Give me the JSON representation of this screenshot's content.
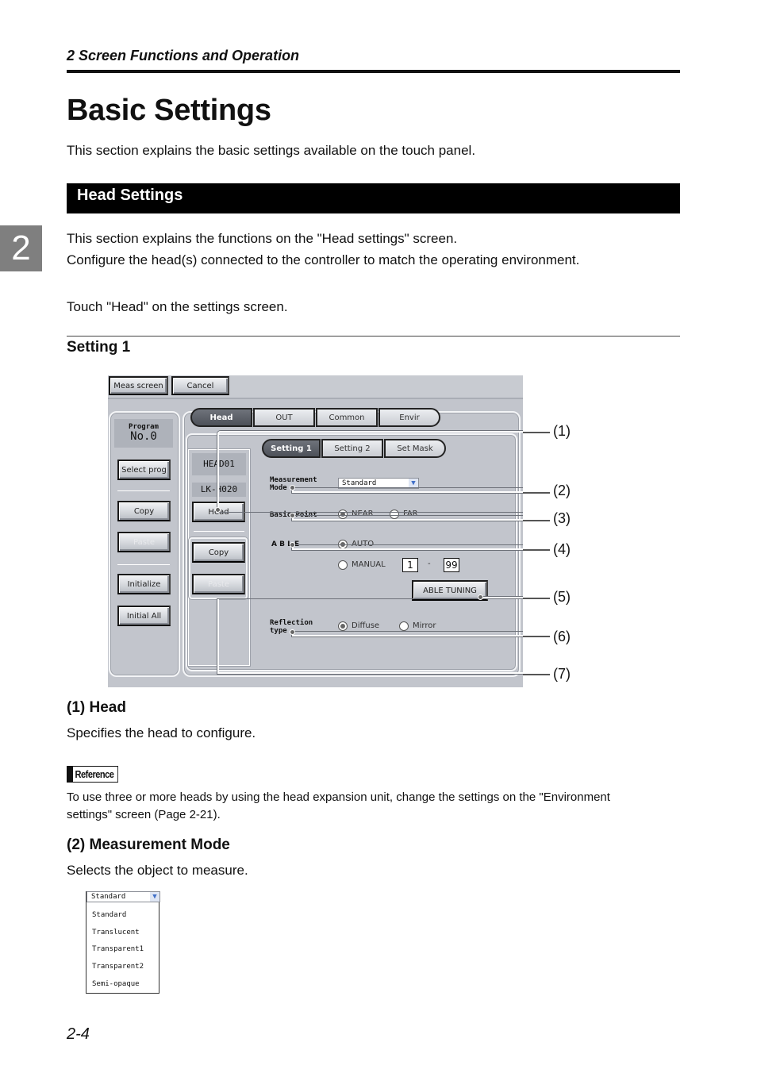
{
  "running_head": "2  Screen Functions and Operation",
  "chapter_tab": "2",
  "title": "Basic Settings",
  "intro": "This section explains the basic settings available on the touch panel.",
  "section_bar": "Head Settings",
  "section_text": [
    "This section explains the functions on the \"Head settings\" screen.",
    "Configure the head(s) connected to the controller to match the operating environment."
  ],
  "instruction": "Touch \"Head\" on the settings screen.",
  "subsection": "Setting 1",
  "screen": {
    "top_buttons": {
      "meas_screen": "Meas screen",
      "cancel": "Cancel"
    },
    "left_panel": {
      "program_label": "Program",
      "program_no": "No.0",
      "select_prog": "Select prog",
      "copy": "Copy",
      "paste": "Paste",
      "initialize": "Initialize",
      "initial_all": "Initial All"
    },
    "main_tabs": [
      "Head",
      "OUT",
      "Common",
      "Envir"
    ],
    "head_column": {
      "head_id": "HEAD01",
      "model": "LK-H020",
      "head_button": "Head",
      "copy": "Copy",
      "paste": "Paste"
    },
    "sub_tabs": [
      "Setting 1",
      "Setting 2",
      "Set Mask"
    ],
    "measurement_mode": {
      "label_line1": "Measurement",
      "label_line2": "Mode",
      "value": "Standard"
    },
    "basic_point": {
      "label": "Basic Point",
      "options": [
        "NEAR",
        "FAR"
      ],
      "selected": "NEAR"
    },
    "able": {
      "label": "A B L E",
      "auto": "AUTO",
      "manual": "MANUAL",
      "min": "1",
      "dash": "-",
      "max": "99",
      "selected": "AUTO"
    },
    "able_tuning": "ABLE TUNING",
    "reflection_type": {
      "label_line1": "Reflection",
      "label_line2": "type",
      "options": [
        "Diffuse",
        "Mirror"
      ],
      "selected": "Diffuse"
    }
  },
  "callouts": [
    "(1)",
    "(2)",
    "(3)",
    "(4)",
    "(5)",
    "(6)",
    "(7)"
  ],
  "item1": {
    "heading": "(1) Head",
    "text": "Specifies the head to configure.",
    "reference_label": "Reference",
    "reference_text_1": "To use three or more heads by using the head expansion unit, change the settings on the \"Environment",
    "reference_text_2": "settings\" screen (Page 2-21)."
  },
  "item2": {
    "heading": "(2) Measurement Mode",
    "text": "Selects the object to measure.",
    "dropdown": {
      "selected": "Standard",
      "arrow": "▼",
      "options": [
        "Standard",
        "Translucent",
        "Transparent1",
        "Transparent2",
        "Semi-opaque"
      ]
    }
  },
  "page_number": "2-4"
}
